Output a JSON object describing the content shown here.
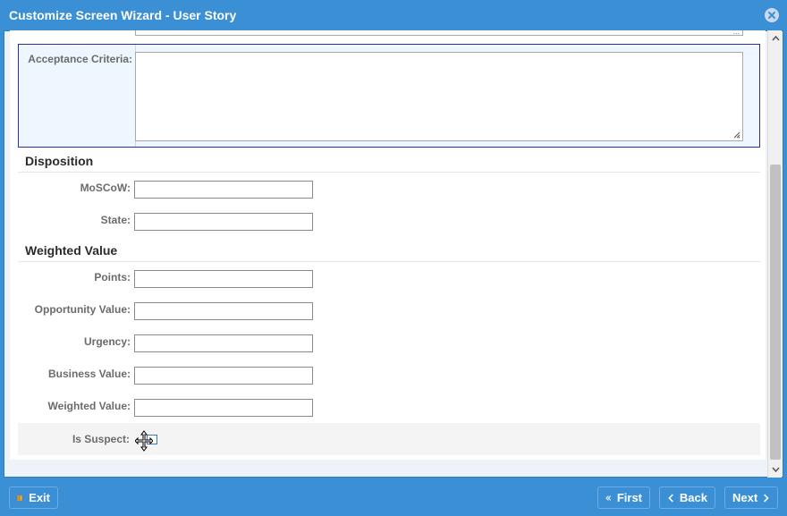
{
  "window": {
    "title": "Customize Screen Wizard - User Story",
    "close_icon": "close-circle-icon"
  },
  "form": {
    "acceptance_criteria": {
      "label": "Acceptance Criteria:",
      "value": ""
    },
    "sections": {
      "disposition": {
        "title": "Disposition",
        "fields": {
          "moscow": {
            "label": "MoSCoW:",
            "value": ""
          },
          "state": {
            "label": "State:",
            "value": ""
          }
        }
      },
      "weighted_value": {
        "title": "Weighted Value",
        "fields": {
          "points": {
            "label": "Points:",
            "value": ""
          },
          "opportunity_value": {
            "label": "Opportunity Value:",
            "value": ""
          },
          "urgency": {
            "label": "Urgency:",
            "value": ""
          },
          "business_value": {
            "label": "Business Value:",
            "value": ""
          },
          "weighted_value": {
            "label": "Weighted Value:",
            "value": ""
          }
        }
      }
    },
    "is_suspect": {
      "label": "Is Suspect:",
      "checked": false
    }
  },
  "footer": {
    "exit_label": "Exit",
    "first_label": "First",
    "back_label": "Back",
    "next_label": "Next"
  },
  "colors": {
    "accent": "#3a8fd5",
    "selected_row_border": "#2b2e9c",
    "selected_row_bg": "#eef6ff"
  }
}
